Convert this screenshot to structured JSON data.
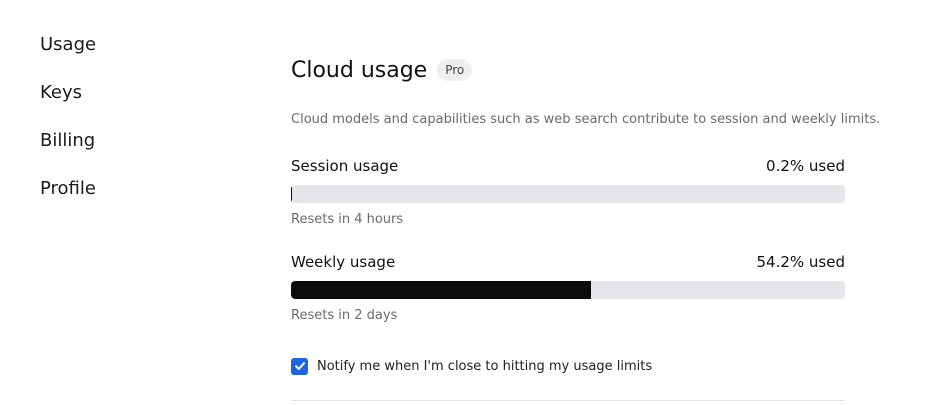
{
  "sidebar": {
    "items": [
      {
        "label": "Usage"
      },
      {
        "label": "Keys"
      },
      {
        "label": "Billing"
      },
      {
        "label": "Profile"
      }
    ]
  },
  "main": {
    "title": "Cloud usage",
    "badge": "Pro",
    "description": "Cloud models and capabilities such as web search contribute to session and weekly limits.",
    "session": {
      "label": "Session usage",
      "used_text": "0.2% used",
      "used_percent": 0.2,
      "reset_text": "Resets in 4 hours"
    },
    "weekly": {
      "label": "Weekly usage",
      "used_text": "54.2% used",
      "used_percent": 54.2,
      "reset_text": "Resets in 2 days"
    },
    "notify": {
      "label": "Notify me when I'm close to hitting my usage limits",
      "checked": true
    }
  },
  "colors": {
    "accent": "#1f63e0",
    "bar_fill": "#0b0b0b",
    "bar_track": "#e6e6ea"
  },
  "icons": {
    "checkbox": "check-icon"
  }
}
